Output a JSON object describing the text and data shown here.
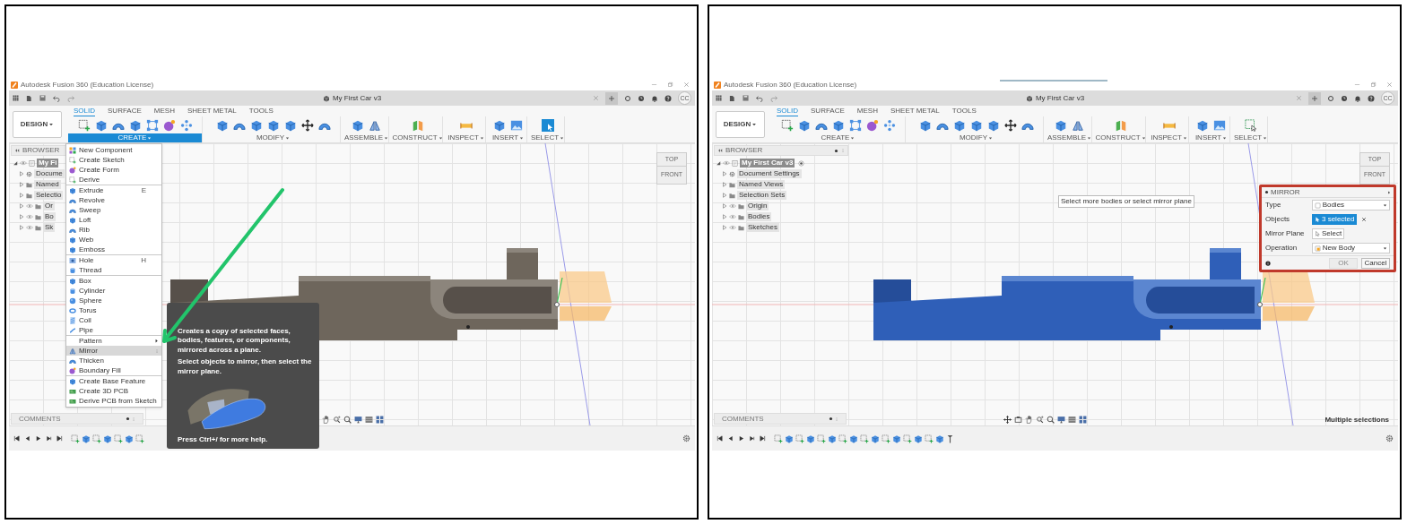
{
  "panels": [
    {
      "app_title": "Autodesk Fusion 360 (Education License)",
      "document_title": "My First Car v3",
      "user_initials": "CC",
      "workspace": "DESIGN",
      "toolbar_tabs": [
        {
          "label": "SOLID",
          "selected": true
        },
        {
          "label": "SURFACE",
          "selected": false
        },
        {
          "label": "MESH",
          "selected": false
        },
        {
          "label": "SHEET METAL",
          "selected": false
        },
        {
          "label": "TOOLS",
          "selected": false
        }
      ],
      "tool_groups": [
        {
          "label": "CREATE",
          "open": true
        },
        {
          "label": "MODIFY",
          "open": false
        },
        {
          "label": "ASSEMBLE",
          "open": false
        },
        {
          "label": "CONSTRUCT",
          "open": false
        },
        {
          "label": "INSPECT",
          "open": false
        },
        {
          "label": "INSERT",
          "open": false
        },
        {
          "label": "SELECT",
          "open": false
        }
      ],
      "select_tool_active": true,
      "browser": {
        "title": "BROWSER",
        "items": [
          {
            "label": "My Fi",
            "kind": "component",
            "expanded": true,
            "selected": true,
            "children": [
              {
                "label": "Docume",
                "kind": "settings",
                "expanded": false,
                "selected": false
              },
              {
                "label": "Named",
                "kind": "folder",
                "expanded": false,
                "selected": false
              },
              {
                "label": "Selectio",
                "kind": "folder",
                "expanded": false,
                "selected": false
              },
              {
                "label": "Or",
                "kind": "visible-folder",
                "expanded": false,
                "selected": false
              },
              {
                "label": "Bo",
                "kind": "visible-folder",
                "expanded": false,
                "selected": false
              },
              {
                "label": "Sk",
                "kind": "visible-folder",
                "expanded": false,
                "selected": false
              }
            ]
          }
        ]
      },
      "bodies_selected": false,
      "viewcube": {
        "top": "TOP",
        "front": "FRONT"
      },
      "create_menu": {
        "sections": [
          [
            {
              "label": "New Component",
              "selected": false
            },
            {
              "label": "Create Sketch",
              "selected": false
            },
            {
              "label": "Create Form",
              "selected": false
            },
            {
              "label": "Derive",
              "selected": false
            }
          ],
          [
            {
              "label": "Extrude",
              "shortcut": "E",
              "selected": false
            },
            {
              "label": "Revolve",
              "selected": false
            },
            {
              "label": "Sweep",
              "selected": false
            },
            {
              "label": "Loft",
              "selected": false
            },
            {
              "label": "Rib",
              "selected": false
            },
            {
              "label": "Web",
              "selected": false
            },
            {
              "label": "Emboss",
              "selected": false
            }
          ],
          [
            {
              "label": "Hole",
              "shortcut": "H",
              "selected": false
            },
            {
              "label": "Thread",
              "selected": false
            }
          ],
          [
            {
              "label": "Box",
              "selected": false
            },
            {
              "label": "Cylinder",
              "selected": false
            },
            {
              "label": "Sphere",
              "selected": false
            },
            {
              "label": "Torus",
              "selected": false
            },
            {
              "label": "Coil",
              "selected": false
            },
            {
              "label": "Pipe",
              "selected": false
            }
          ],
          [
            {
              "label": "Pattern",
              "kind": "submenu",
              "selected": false
            },
            {
              "label": "Mirror",
              "selected": true
            },
            {
              "label": "Thicken",
              "selected": false
            },
            {
              "label": "Boundary Fill",
              "selected": false
            }
          ],
          [
            {
              "label": "Create Base Feature",
              "selected": false
            },
            {
              "label": "Create 3D PCB",
              "selected": false
            },
            {
              "label": "Derive PCB from Sketch",
              "selected": false
            }
          ]
        ]
      },
      "tooltip": {
        "description": "Creates a copy of selected faces, bodies, features, or components, mirrored across a plane.",
        "instruction": "Select objects to mirror, then select the mirror plane.",
        "help": "Press Ctrl+/ for more help."
      },
      "annotation_arrow": true,
      "comments": "COMMENTS"
    },
    {
      "app_title": "Autodesk Fusion 360 (Education License)",
      "loading": true,
      "document_title": "My First Car v3",
      "user_initials": "CC",
      "workspace": "DESIGN",
      "toolbar_tabs": [
        {
          "label": "SOLID",
          "selected": true
        },
        {
          "label": "SURFACE",
          "selected": false
        },
        {
          "label": "MESH",
          "selected": false
        },
        {
          "label": "SHEET METAL",
          "selected": false
        },
        {
          "label": "TOOLS",
          "selected": false
        }
      ],
      "tool_groups": [
        {
          "label": "CREATE",
          "open": false
        },
        {
          "label": "MODIFY",
          "open": false
        },
        {
          "label": "ASSEMBLE",
          "open": false
        },
        {
          "label": "CONSTRUCT",
          "open": false
        },
        {
          "label": "INSPECT",
          "open": false
        },
        {
          "label": "INSERT",
          "open": false
        },
        {
          "label": "SELECT",
          "open": false
        }
      ],
      "select_tool_active": false,
      "browser": {
        "title": "BROWSER",
        "items": [
          {
            "label": "My First Car v3",
            "kind": "component",
            "expanded": true,
            "selected": true,
            "active": true,
            "children": [
              {
                "label": "Document Settings",
                "kind": "settings",
                "expanded": false,
                "selected": false
              },
              {
                "label": "Named Views",
                "kind": "folder",
                "expanded": false,
                "selected": false
              },
              {
                "label": "Selection Sets",
                "kind": "folder",
                "expanded": false,
                "selected": false
              },
              {
                "label": "Origin",
                "kind": "visible-folder",
                "expanded": false,
                "selected": false
              },
              {
                "label": "Bodies",
                "kind": "visible-folder",
                "expanded": false,
                "selected": false
              },
              {
                "label": "Sketches",
                "kind": "visible-folder",
                "expanded": false,
                "selected": false
              }
            ]
          }
        ]
      },
      "bodies_selected": true,
      "viewcube": {
        "top": "TOP",
        "front": "FRONT"
      },
      "viewport_hint": "Select more bodies or select mirror plane",
      "mirror_dialog": {
        "title": "MIRROR",
        "highlighted": true,
        "rows": [
          {
            "label": "Type",
            "kind": "dropdown",
            "value": "Bodies"
          },
          {
            "label": "Objects",
            "kind": "selection",
            "value": "3 selected"
          },
          {
            "label": "Mirror Plane",
            "kind": "picker",
            "value": "Select"
          },
          {
            "label": "Operation",
            "kind": "dropdown",
            "value": "New Body"
          }
        ],
        "buttons": [
          {
            "label": "OK",
            "disabled": true
          },
          {
            "label": "Cancel",
            "disabled": false
          }
        ]
      },
      "comments": "COMMENTS",
      "status": "Multiple selections"
    }
  ]
}
